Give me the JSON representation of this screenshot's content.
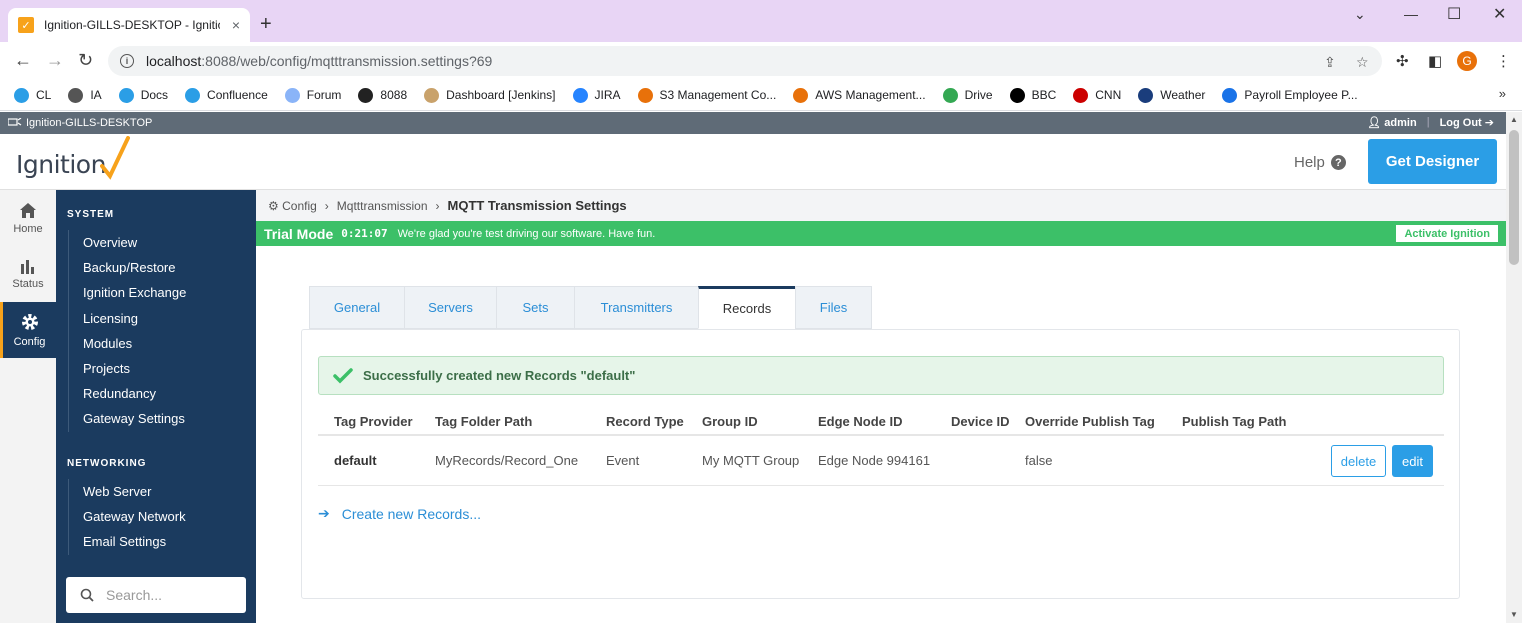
{
  "browser": {
    "tab_title": "Ignition-GILLS-DESKTOP - Ignitio",
    "tab_close": "×",
    "new_tab": "+",
    "url_host": "localhost",
    "url_rest": ":8088/web/config/mqtttransmission.settings?69",
    "avatar_letter": "G",
    "bookmarks": [
      {
        "label": "CL",
        "color": "#2b9ee6"
      },
      {
        "label": "IA",
        "color": "#555555"
      },
      {
        "label": "Docs",
        "color": "#2b9ee6"
      },
      {
        "label": "Confluence",
        "color": "#2b9ee6"
      },
      {
        "label": "Forum",
        "color": "#8ab4f8"
      },
      {
        "label": "8088",
        "color": "#222222"
      },
      {
        "label": "Dashboard [Jenkins]",
        "color": "#c9a26b"
      },
      {
        "label": "JIRA",
        "color": "#2684ff"
      },
      {
        "label": "S3 Management Co...",
        "color": "#e8710a"
      },
      {
        "label": "AWS Management...",
        "color": "#e8710a"
      },
      {
        "label": "Drive",
        "color": "#34a853"
      },
      {
        "label": "BBC",
        "color": "#000000"
      },
      {
        "label": "CNN",
        "color": "#cc0000"
      },
      {
        "label": "Weather",
        "color": "#1a3d7c"
      },
      {
        "label": "Payroll Employee P...",
        "color": "#1a73e8"
      }
    ],
    "bookmarks_more": "»"
  },
  "gateway": {
    "name": "Ignition-GILLS-DESKTOP",
    "user": "admin",
    "logout": "Log Out",
    "logo_text": "Ignition",
    "help": "Help",
    "get_designer": "Get Designer"
  },
  "icon_nav": [
    {
      "label": "Home",
      "icon": "home-icon"
    },
    {
      "label": "Status",
      "icon": "bar-chart-icon"
    },
    {
      "label": "Config",
      "icon": "gear-icon",
      "active": true
    }
  ],
  "sidebar": {
    "system_title": "SYSTEM",
    "system_items": [
      "Overview",
      "Backup/Restore",
      "Ignition Exchange",
      "Licensing",
      "Modules",
      "Projects",
      "Redundancy",
      "Gateway Settings"
    ],
    "networking_title": "NETWORKING",
    "networking_items": [
      "Web Server",
      "Gateway Network",
      "Email Settings"
    ],
    "search_placeholder": "Search..."
  },
  "breadcrumb": {
    "root": "Config",
    "parent": "Mqtttransmission",
    "current": "MQTT Transmission Settings"
  },
  "trial": {
    "label": "Trial Mode",
    "time": "0:21:07",
    "message": "We're glad you're test driving our software. Have fun.",
    "activate": "Activate Ignition"
  },
  "tabs": [
    {
      "label": "General",
      "width": 95
    },
    {
      "label": "Servers",
      "width": 92
    },
    {
      "label": "Sets",
      "width": 78
    },
    {
      "label": "Transmitters",
      "width": 124
    },
    {
      "label": "Records",
      "width": 97,
      "active": true
    },
    {
      "label": "Files",
      "width": 77
    }
  ],
  "success_message": "Successfully created new Records \"default\"",
  "table": {
    "columns": [
      "Tag Provider",
      "Tag Folder Path",
      "Record Type",
      "Group ID",
      "Edge Node ID",
      "Device ID",
      "Override Publish Tag",
      "Publish Tag Path"
    ],
    "rows": [
      {
        "tag_provider": "default",
        "tag_folder_path": "MyRecords/Record_One",
        "record_type": "Event",
        "group_id": "My MQTT Group",
        "edge_node_id": "Edge Node 994161",
        "device_id": "",
        "override_publish_tag": "false",
        "publish_tag_path": ""
      }
    ],
    "delete_label": "delete",
    "edit_label": "edit"
  },
  "create_link": "Create new Records..."
}
